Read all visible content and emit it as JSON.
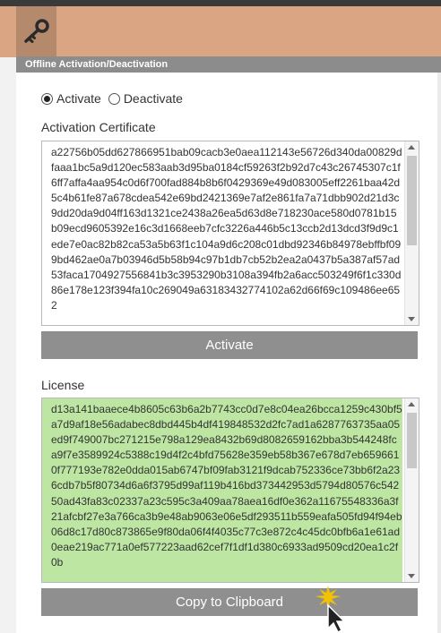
{
  "header": {
    "icon": "key-icon"
  },
  "panel": {
    "title": "Offline Activation/Deactivation"
  },
  "mode": {
    "options": [
      {
        "label": "Activate",
        "checked": true
      },
      {
        "label": "Deactivate",
        "checked": false
      }
    ]
  },
  "certificate": {
    "label": "Activation Certificate",
    "value": "a22756b05dd627866951bab09cacb3e0aea112143e56726d340da00829dfaaa1bc5a9d120ec583aab3d95ba0184cf59263f2b92d7c43c26745307c1f6ff7affa4aa954c0d6f700fad884b8b6f0429369e49d083005eff2261baa42d5c4b61fe87a678cdea542e69bd2421369e7af2e861fa7a71dbb902d21d3c9dd20da9d04ff163d1321ce2438a26ea5d63d8e718230ace580d0781b15b09ecd9605392e16c3d1668eeb7cfc3226a446b5c13ccb2d13dcd3f9d9c1ede7e0ac82b82ca53a5b63f1c104a9d6c208c01dbd92346b84978ebffbf099bd462ae0a7b03946d5b58b94c97b1db7cb52b2ea2a0437b5a387af57ad53faca1704927556841b3c3953290b3108a394fb2a6acc503249f6f1c330d86e178e123f394fa10c269049a63183432774102a62d66f69c109486ee652"
  },
  "activate_button": {
    "label": "Activate"
  },
  "license": {
    "label": "License",
    "value": "d13a141baaece4b8605c63b6a2b7743cc0d7e8c04ea26bcca1259c430bf5a7d9af18e56adabec8dbd445b4df419848532d2fc7ad1a6287763735aa05ed9f749007bc271215e798a129ea8432b69d8082659162bba3b544248fca9f7e3589924c5388c19d4f2c4bfd75628e359eb58b367e678d7eb6596610f777193e782e0dda015ab6747bf09fab3121f9dcab752336ce73bb6f2a236cdb7b5f80734d6a6f3795d99af119b416bd373442953d5794d80576c54250ad43fa83c02337a23c595c3a409aa78aea16df0e362a11675548336a3f21afcbf27e3a766ca3b9e48ab9063e06e5df293511b559eafa505fd94f94eb06d8c17d80c873865e9f80da06f4f4035c77c3e872c4c45dc0bfb6a1e61ad0eae219ac771a0ef577223aad62cef7f1df1d380c6933ad9509cd20ea1c2f0b"
  },
  "copy_button": {
    "label": "Copy to Clipboard"
  },
  "colors": {
    "header": "#d9a582",
    "titlebar": "#8c8c8c",
    "button": "#8f8f8f",
    "license_bg": "#bde6a3"
  }
}
